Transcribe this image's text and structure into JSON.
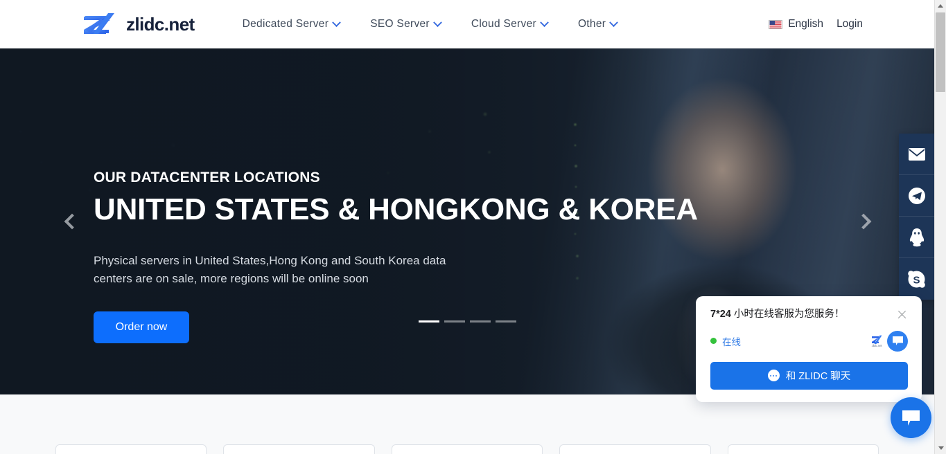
{
  "brand": {
    "name": "zlidc.net",
    "logo_icon": "zlidc-z-logo"
  },
  "nav": {
    "items": [
      {
        "label": "Dedicated Server",
        "icon": "chevron-down-icon"
      },
      {
        "label": "SEO Server",
        "icon": "chevron-down-icon"
      },
      {
        "label": "Cloud Server",
        "icon": "chevron-down-icon"
      },
      {
        "label": "Other",
        "icon": "chevron-down-icon"
      }
    ]
  },
  "header_right": {
    "language": "English",
    "language_flag": "us-flag-icon",
    "login": "Login"
  },
  "hero": {
    "kicker": "OUR DATACENTER LOCATIONS",
    "title": "UNITED STATES & HONGKONG & KOREA",
    "subtitle": "Physical servers in United States,Hong Kong and South Korea data centers are on sale, more regions will be online soon",
    "cta_label": "Order now",
    "cta_color": "#0d6efd",
    "prev_icon": "chevron-left-icon",
    "next_icon": "chevron-right-icon",
    "slide_count": 4,
    "active_slide": 1
  },
  "social_rail": {
    "items": [
      {
        "icon": "envelope-icon",
        "name": "email"
      },
      {
        "icon": "telegram-icon",
        "name": "telegram"
      },
      {
        "icon": "qq-penguin-icon",
        "name": "qq"
      },
      {
        "icon": "skype-icon",
        "name": "skype"
      }
    ]
  },
  "chat_widget": {
    "title_bold": "7*24",
    "title_rest": " 小时在线客服为您服务！",
    "close_icon": "close-icon",
    "status_dot_color": "#34c23c",
    "status_text": "在线",
    "agent_logo": "zlidc-mini-logo",
    "agent_logo_sub": "zlidc.net",
    "agent_avatar_icon": "chat-bubble-icon",
    "cta_label": "和 ZLIDC 聊天",
    "cta_icon": "chat-bubble-icon",
    "cta_color": "#1a73e8"
  },
  "chat_fab": {
    "icon": "chat-bubble-icon",
    "color": "#1a73e8"
  },
  "scrollbar": {
    "up_icon": "triangle-up-icon",
    "down_icon": "triangle-down-icon"
  }
}
